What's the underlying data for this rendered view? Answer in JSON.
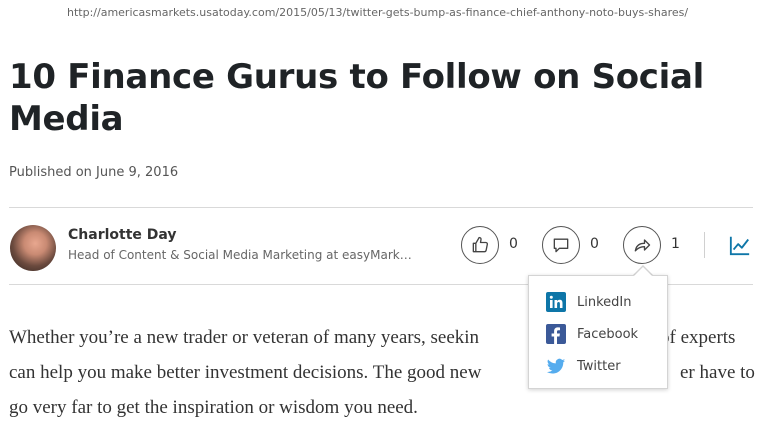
{
  "url": "http://americasmarkets.usatoday.com/2015/05/13/twitter-gets-bump-as-finance-chief-anthony-noto-buys-shares/",
  "article": {
    "title": "10 Finance Gurus to Follow on Social Media",
    "published": "Published on June 9, 2016",
    "body_lines": [
      "Whether you’re a new trader or veteran of many years, seekin",
      "can help you make better investment decisions. The good new",
      "go very far to get the inspiration or wisdom you need."
    ],
    "body_right_fragments": [
      "of experts",
      "er have to"
    ]
  },
  "author": {
    "name": "Charlotte Day",
    "headline": "Head of Content & Social Media Marketing at easyMark…"
  },
  "actions": {
    "like_count": "0",
    "comment_count": "0",
    "share_count": "1"
  },
  "share_menu": {
    "items": [
      {
        "label": "LinkedIn",
        "icon": "linkedin-icon",
        "color": "#0e76a8"
      },
      {
        "label": "Facebook",
        "icon": "facebook-icon",
        "color": "#3b5998"
      },
      {
        "label": "Twitter",
        "icon": "twitter-icon",
        "color": "#55acee"
      }
    ]
  },
  "colors": {
    "accent": "#0e76a8"
  }
}
